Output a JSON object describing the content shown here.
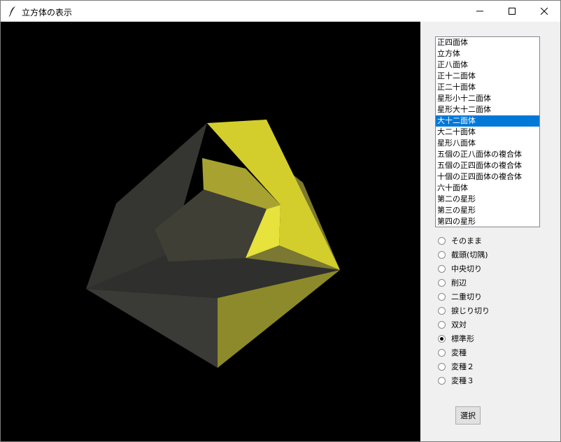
{
  "window": {
    "title": "立方体の表示"
  },
  "polyhedra_list": {
    "items": [
      "正四面体",
      "立方体",
      "正八面体",
      "正十二面体",
      "正二十面体",
      "星形小十二面体",
      "星形大十二面体",
      "大十二面体",
      "大二十面体",
      "星形八面体",
      "五個の正八面体の複合体",
      "五個の正四面体の複合体",
      "十個の正四面体の複合体",
      "六十面体",
      "第二の星形",
      "第三の星形",
      "第四の星形"
    ],
    "selected_index": 7
  },
  "transform_options": {
    "items": [
      "そのまま",
      "截頭(切隅)",
      "中央切り",
      "削辺",
      "二重切り",
      "捩じり切り",
      "双対",
      "標準形",
      "変種",
      "変種２",
      "変種３"
    ],
    "selected_index": 7
  },
  "select_button": {
    "label": "選択"
  },
  "colors": {
    "selection": "#0078d7",
    "canvas_bg": "#000000"
  }
}
